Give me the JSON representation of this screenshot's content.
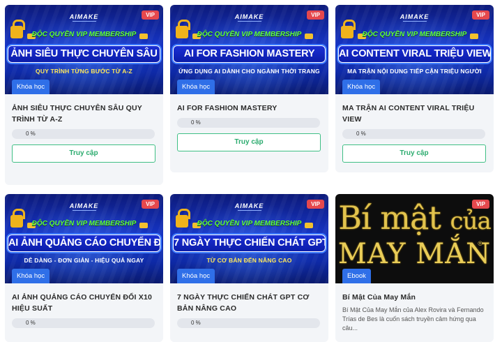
{
  "cards": [
    {
      "badge": "VIP",
      "type": "Khóa học",
      "thumb": {
        "brand": "AIMAKE",
        "top": "ĐỘC QUYỀN VIP MEMBERSHIP",
        "title": "ẢNH SIÊU THỰC CHUYÊN SÂU",
        "sub": "QUY TRÌNH TỪNG BƯỚC TỪ A-Z"
      },
      "title": "ẢNH SIÊU THỰC CHUYÊN SÂU QUY TRÌNH TỪ A-Z",
      "progress": "0 %",
      "progress_value": 0,
      "button": "Truy cập"
    },
    {
      "badge": "VIP",
      "type": "Khóa học",
      "thumb": {
        "brand": "AIMAKE",
        "top": "ĐỘC QUYỀN VIP MEMBERSHIP",
        "title": "AI FOR FASHION MASTERY",
        "sub": "ỨNG DỤNG AI DÀNH CHO NGÀNH THỜI TRANG"
      },
      "title": "AI FOR FASHION MASTERY",
      "progress": "0 %",
      "progress_value": 0,
      "button": "Truy cập"
    },
    {
      "badge": "VIP",
      "type": "Khóa học",
      "thumb": {
        "brand": "AIMAKE",
        "top": "ĐỘC QUYỀN VIP MEMBERSHIP",
        "title": "AI CONTENT VIRAL TRIỆU VIEW",
        "sub": "MA TRẬN NỘI DUNG TIẾP CẬN TRIỆU NGƯỜI"
      },
      "title": "MA TRẬN AI CONTENT VIRAL TRIỆU VIEW",
      "progress": "0 %",
      "progress_value": 0,
      "button": "Truy cập"
    },
    {
      "badge": "VIP",
      "type": "Khóa học",
      "thumb": {
        "brand": "AIMAKE",
        "top": "ĐỘC QUYỀN VIP MEMBERSHIP",
        "title": "AI ẢNH QUẢNG CÁO CHUYỂN ĐỔI",
        "sub": "DỄ DÀNG - ĐƠN GIẢN - HIỆU QUẢ NGAY"
      },
      "title": "AI ẢNH QUẢNG CÁO CHUYỂN ĐỔI X10 HIỆU SUẤT",
      "progress": "0 %",
      "progress_value": 0
    },
    {
      "badge": "VIP",
      "type": "Khóa học",
      "thumb": {
        "brand": "AIMAKE",
        "top": "ĐỘC QUYỀN VIP MEMBERSHIP",
        "title": "7 NGÀY THỰC CHIẾN CHÁT GPT",
        "sub": "TỪ CƠ BẢN ĐẾN NÂNG CAO"
      },
      "title": "7 NGÀY THỰC CHIẾN CHÁT GPT CƠ BẢN NÂNG CAO",
      "progress": "0 %",
      "progress_value": 0
    },
    {
      "badge": "VIP",
      "type": "Ebook",
      "thumb": {
        "line1a": "Bí mật",
        "line1b": "của",
        "line2": "MAY MẮN",
        "reg": "®"
      },
      "title": "Bí Mật Của May Mắn",
      "description": "Bí Mật Của May Mắn của Alex Rovira và Fernando Trías de Bes là cuốn sách truyền cảm hứng qua câu..."
    }
  ],
  "colors": {
    "vip_badge": "#e5484d",
    "type_badge": "#2f6fe8",
    "button_border": "#3fbf85",
    "button_text": "#2bab6e",
    "progress_track": "#e3e6ec"
  }
}
